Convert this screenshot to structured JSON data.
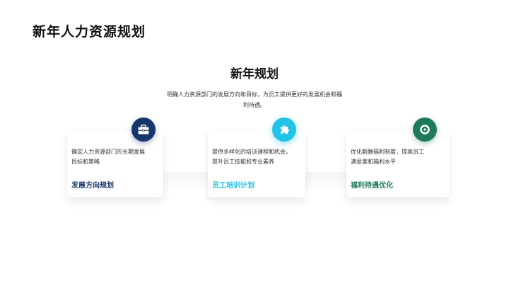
{
  "slide": {
    "title": "新年人力资源规划",
    "heading": "新年规划",
    "intro_line1": "明确人力资源部门的发展方向和目标，为员工提供更好的发展机会和福",
    "intro_line2": "利待遇。"
  },
  "cards": [
    {
      "icon": "briefcase-icon",
      "desc_line1": "确定人力资源部门的长期发展",
      "desc_line2": "目标和策略",
      "label": "发展方向规划"
    },
    {
      "icon": "puzzle-icon",
      "desc_line1": "提供多样化的培训课程和机会，",
      "desc_line2": "提升员工技能和专业素养",
      "label": "员工培训计划"
    },
    {
      "icon": "ring-icon",
      "desc_line1": "优化薪酬福利制度，提高员工",
      "desc_line2": "满意度和福利水平",
      "label": "福利待遇优化"
    }
  ],
  "colors": {
    "navy": "#17366b",
    "cyan": "#22c3e6",
    "green": "#1f7a5c"
  }
}
